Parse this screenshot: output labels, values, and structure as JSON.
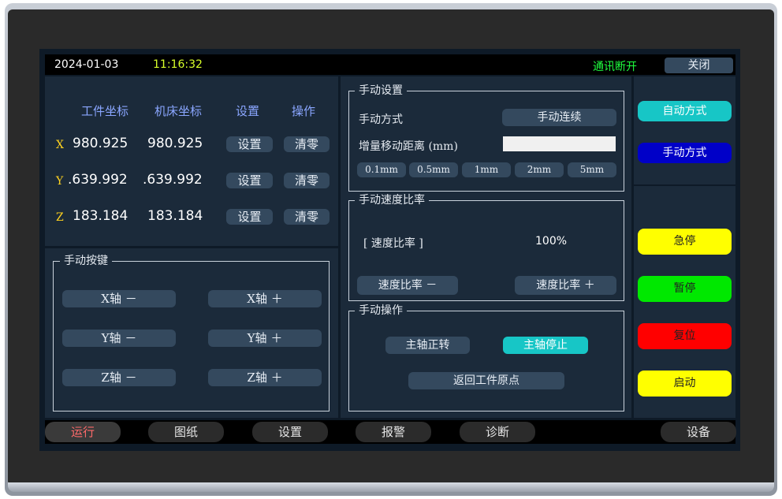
{
  "status_bar": {
    "date": "2024-01-03",
    "time": "11:16:32",
    "connection_status": "通讯断开",
    "close_label": "关闭"
  },
  "coords": {
    "headers": [
      "工件坐标",
      "机床坐标",
      "设置",
      "操作"
    ],
    "rows": [
      {
        "axis": "X",
        "work": "980.925",
        "machine": "980.925",
        "set_label": "设置",
        "zero_label": "清零"
      },
      {
        "axis": "Y",
        "work": ".639.992",
        "machine": ".639.992",
        "set_label": "设置",
        "zero_label": "清零"
      },
      {
        "axis": "Z",
        "work": "183.184",
        "machine": "183.184",
        "set_label": "设置",
        "zero_label": "清零"
      }
    ]
  },
  "manual_keys": {
    "title": "手动按键",
    "buttons": [
      "X轴 －",
      "X轴 ＋",
      "Y轴 －",
      "Y轴 ＋",
      "Z轴 －",
      "Z轴 ＋"
    ]
  },
  "manual_settings": {
    "title": "手动设置",
    "mode_label": "手动方式",
    "mode_value": "手动连续",
    "step_label": "增量移动距离 (mm)",
    "step_input_value": "",
    "steps": [
      "0.1mm",
      "0.5mm",
      "1mm",
      "2mm",
      "5mm"
    ]
  },
  "speed_ratio": {
    "title": "手动速度比率",
    "label": "[ 速度比率 ]",
    "value": "100%",
    "dec_label": "速度比率 －",
    "inc_label": "速度比率 ＋"
  },
  "manual_ops": {
    "title": "手动操作",
    "spindle_fwd": "主轴正转",
    "spindle_stop": "主轴停止",
    "return_origin": "返回工件原点"
  },
  "side_buttons": [
    {
      "label": "自动方式",
      "color": "#17c6c6",
      "text_color": "#ffffff"
    },
    {
      "label": "手动方式",
      "color": "#0000c8",
      "text_color": "#ffffff"
    },
    {
      "label": "急停",
      "color": "#ffff00",
      "text_color": "#222222"
    },
    {
      "label": "暂停",
      "color": "#00e800",
      "text_color": "#222222"
    },
    {
      "label": "复位",
      "color": "#ff0000",
      "text_color": "#222222"
    },
    {
      "label": "启动",
      "color": "#ffff00",
      "text_color": "#222222"
    }
  ],
  "bottom_nav": [
    "运行",
    "图纸",
    "设置",
    "报警",
    "诊断",
    "设备"
  ],
  "colors": {
    "time": "#d8ff2a",
    "status": "#1fff3f",
    "axis": "#ffd21f",
    "header": "#8aa6ff",
    "active_nav": "#ff6a6a"
  }
}
